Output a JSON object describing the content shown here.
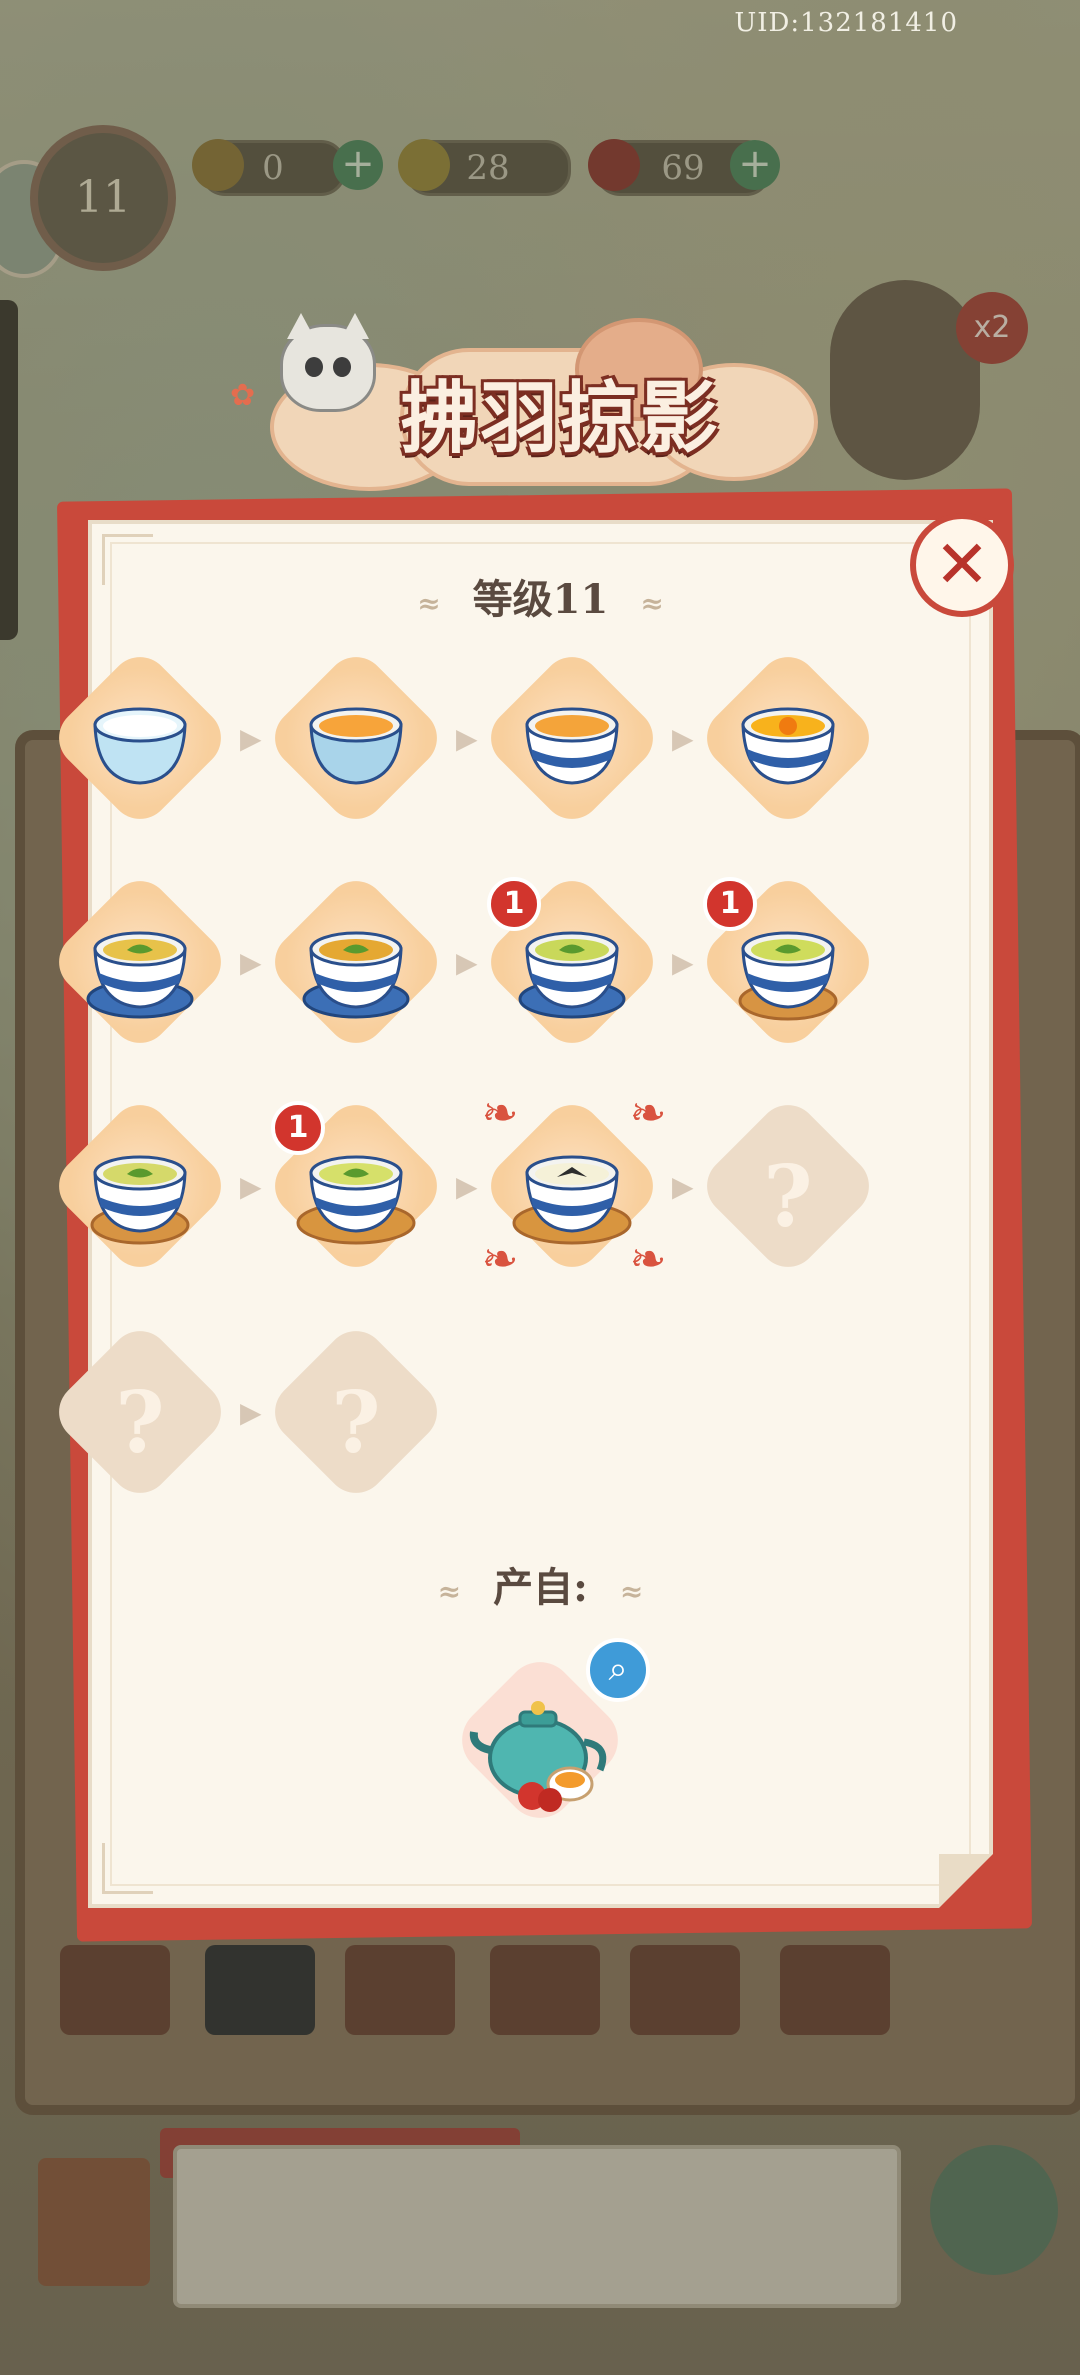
{
  "uid_text": "UID:132181410",
  "hud": {
    "energy_value": "0",
    "coin_value": "28",
    "gem_value": "69",
    "player_level": "11",
    "multiplier_badge": "x2"
  },
  "banner": {
    "title": "拂羽掠影"
  },
  "panel": {
    "level_label": "等级11",
    "source_label": "产自:",
    "close_icon": "close-x-icon",
    "search_icon": "magnifier-icon",
    "source_item": "teapot-set"
  },
  "chain": {
    "items": [
      {
        "icon": "empty-celadon-cup",
        "unlocked": true,
        "badge": ""
      },
      {
        "icon": "tea-cup-orange-brew",
        "unlocked": true,
        "badge": ""
      },
      {
        "icon": "blue-pattern-tea-cup",
        "unlocked": true,
        "badge": ""
      },
      {
        "icon": "chrysanthemum-tea-cup",
        "unlocked": true,
        "badge": ""
      },
      {
        "icon": "covered-tea-cup-on-saucer",
        "unlocked": true,
        "badge": ""
      },
      {
        "icon": "blue-leaf-cup-on-saucer",
        "unlocked": true,
        "badge": ""
      },
      {
        "icon": "green-tea-bowl-on-saucer",
        "unlocked": true,
        "badge": "1"
      },
      {
        "icon": "gaiwan-on-wood-tray",
        "unlocked": true,
        "badge": "1"
      },
      {
        "icon": "tea-jar-on-tray",
        "unlocked": true,
        "badge": ""
      },
      {
        "icon": "green-tea-bowl-on-mat",
        "unlocked": true,
        "badge": "1"
      },
      {
        "icon": "swallow-tea-bowl-set",
        "unlocked": true,
        "badge": "",
        "selected": true
      },
      {
        "icon": "locked-item",
        "unlocked": false,
        "badge": "",
        "qmark": "?"
      },
      {
        "icon": "locked-item",
        "unlocked": false,
        "badge": "",
        "qmark": "?"
      },
      {
        "icon": "locked-item",
        "unlocked": false,
        "badge": "",
        "qmark": "?"
      }
    ]
  },
  "colors": {
    "panel_red": "#c9493b",
    "paper": "#fbf6ec",
    "badge_red": "#d2352d",
    "accent_blue": "#3f9bd8"
  }
}
